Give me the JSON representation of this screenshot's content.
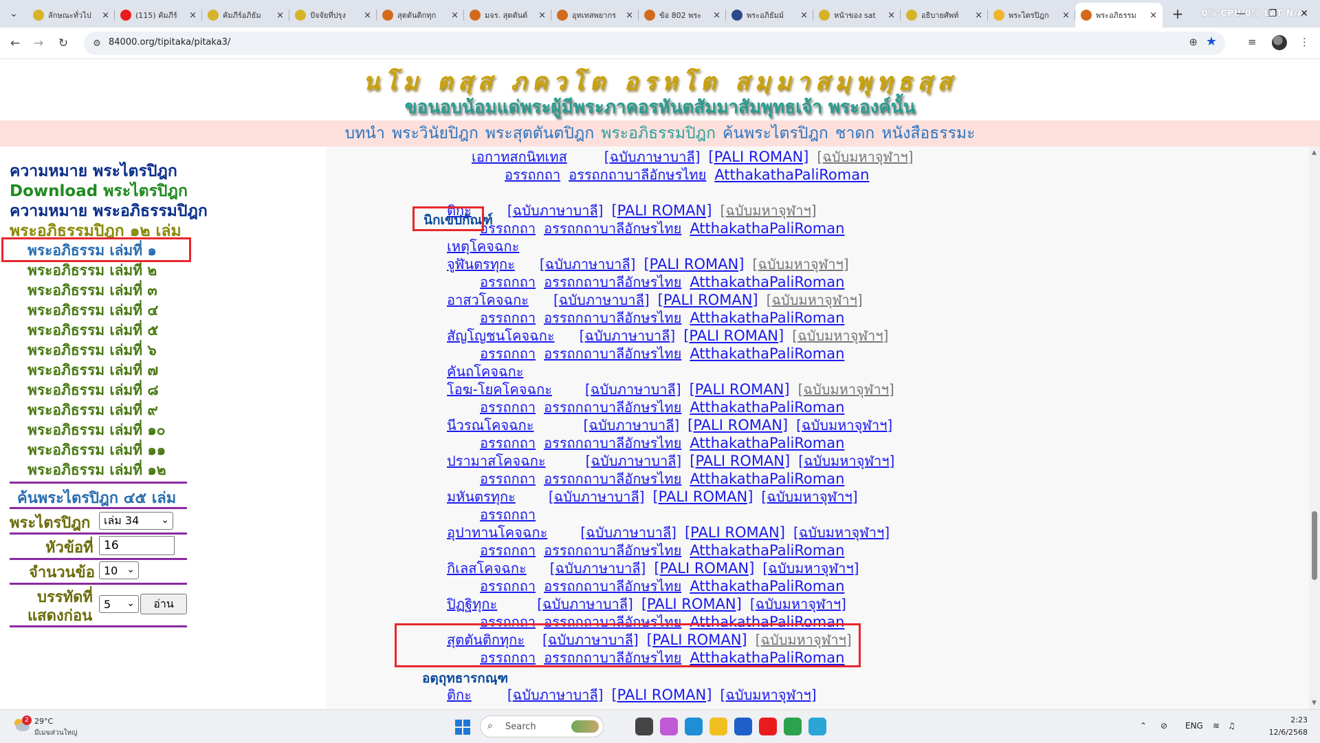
{
  "browser": {
    "tabs": [
      {
        "title": "ลักษณะทั่วไป",
        "fav": "#d6b42a",
        "active": false
      },
      {
        "title": "(115) คัมภีร์",
        "fav": "#e81c1c",
        "active": false
      },
      {
        "title": "คัมภีร์อภิธัม",
        "fav": "#d6b42a",
        "active": false
      },
      {
        "title": "ปัจจัยที่ปรุง",
        "fav": "#d6b42a",
        "active": false
      },
      {
        "title": "สุตตันติกทุก",
        "fav": "#d36a1b",
        "active": false
      },
      {
        "title": "มจร. สุตตันต์",
        "fav": "#d36a1b",
        "active": false
      },
      {
        "title": "อุทเทสพยากร",
        "fav": "#d36a1b",
        "active": false
      },
      {
        "title": "ข้อ 802 พระ",
        "fav": "#d36a1b",
        "active": false
      },
      {
        "title": "พระอภิธัมม์",
        "fav": "#2b4a8a",
        "active": false
      },
      {
        "title": "หน้าของ sat",
        "fav": "#d6b42a",
        "active": false
      },
      {
        "title": "อธิบายศัพท์",
        "fav": "#d6b42a",
        "active": false
      },
      {
        "title": "พระไตรปิฎก",
        "fav": "#f0b42a",
        "active": false
      },
      {
        "title": "พระอภิธรรม",
        "fav": "#d36a1b",
        "active": true
      }
    ],
    "close_glyph": "×",
    "new_tab_glyph": "+",
    "sys_monitor": "0%  CPU 0%  LAT N/A",
    "url": "84000.org/tipitaka/pitaka3/"
  },
  "page": {
    "banner_line1": "นโม ตสฺส ภควโต อรหโต สมฺมาสมฺพุทฺธสฺส",
    "banner_line2": "ขอนอบน้อมแด่พระผู้มีพระภาคอรหันตสัมมาสัมพุทธเจ้า  พระองค์นั้น",
    "topnav": [
      "บทนำ",
      "พระวินัยปิฎก",
      "พระสุตตันตปิฎก",
      "พระอภิธรรมปิฎก",
      "ค้นพระไตรปิฎก",
      "ชาดก",
      "หนังสือธรรมะ"
    ],
    "sidebar": {
      "link_meaning": "ความหมาย พระไตรปิฎก",
      "link_download": "Download พระไตรปิฎก",
      "link_abhidhamma_meaning": "ความหมาย พระอภิธรรมปิฎก",
      "heading": "พระอภิธรรมปิฎก ๑๒ เล่ม",
      "volumes": [
        "พระอภิธรรม เล่มที่ ๑",
        "พระอภิธรรม เล่มที่ ๒",
        "พระอภิธรรม เล่มที่ ๓",
        "พระอภิธรรม เล่มที่ ๔",
        "พระอภิธรรม เล่มที่ ๕",
        "พระอภิธรรม เล่มที่ ๖",
        "พระอภิธรรม เล่มที่ ๗",
        "พระอภิธรรม เล่มที่ ๘",
        "พระอภิธรรม เล่มที่ ๙",
        "พระอภิธรรม เล่มที่ ๑๐",
        "พระอภิธรรม เล่มที่ ๑๑",
        "พระอภิธรรม เล่มที่ ๑๒"
      ],
      "search_heading": "ค้นพระไตรปิฎก ๔๕ เล่ม",
      "label_tipitaka": "พระไตรปิฎก",
      "volume_select": "เล่ม 34",
      "label_item": "หัวข้อที่",
      "item_value": "16",
      "label_count": "จำนวนข้อ",
      "count_select": "10",
      "label_lines_1": "บรรทัดที่",
      "label_lines_2": "แสดงก่อน",
      "lines_select": "5",
      "read_button": "อ่าน"
    },
    "content": {
      "first_item": "เอกาทสกนิทเทส",
      "section_nikkhepa": "นิกเขปกัณฑ์",
      "section_attha": "อตฺถุทธารกณฺฑ",
      "links": {
        "pali": "[ฉบับภาษาบาลี]",
        "roman": "[PALI ROMAN]",
        "mahachula": "[ฉบับมหาจุฬาฯ]",
        "atthakatha": "อรรถกถา",
        "atthakatha_thai": "อรรถกถาบาลีอักษรไทย",
        "atthakatha_roman": "AtthakathaPaliRoman"
      },
      "items": [
        "ติกะ",
        "เหตุโคจฉกะ",
        "จูฬันตรทุกะ",
        "อาสวโคจฉกะ",
        "สัญโญชนโคจฉกะ",
        "คันถโคจฉกะ",
        "โอฆ-โยคโคจฉกะ",
        "นีวรณโคจฉกะ",
        "ปรามาสโคจฉกะ",
        "มหันตรทุกะ",
        "อุปาทานโคจฉกะ",
        "กิเลสโคจฉกะ",
        "ปิฏฐิทุกะ",
        "สุตตันติกทุกะ"
      ],
      "last_item": "ติกะ"
    }
  },
  "taskbar": {
    "weather_badge": "2",
    "temp": "29°C",
    "weather_desc": "มีเมฆส่วนใหญ่",
    "search_label": "Search",
    "lang": "ENG",
    "time": "2:23",
    "date": "12/6/2568",
    "apps": [
      {
        "name": "files-app-icon",
        "color": "#444"
      },
      {
        "name": "copilot-app-icon",
        "color": "#c05ad6"
      },
      {
        "name": "edge-app-icon",
        "color": "#1e8fd7"
      },
      {
        "name": "explorer-app-icon",
        "color": "#f0c020"
      },
      {
        "name": "store-app-icon",
        "color": "#1f5fc8"
      },
      {
        "name": "youtube-app-icon",
        "color": "#e81c1c"
      },
      {
        "name": "chrome-app-icon",
        "color": "#2ba24c"
      },
      {
        "name": "misc-app-icon",
        "color": "#2aa6d6"
      }
    ]
  }
}
